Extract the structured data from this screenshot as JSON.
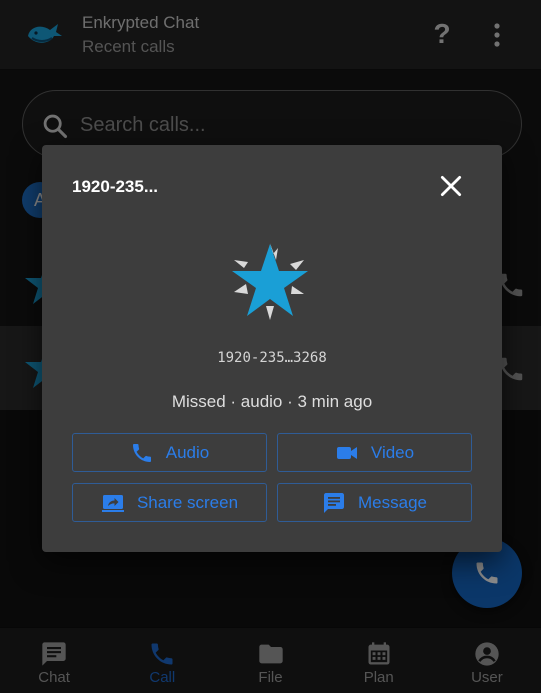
{
  "app": {
    "title": "Enkrypted Chat",
    "subtitle": "Recent calls",
    "help_icon": "?"
  },
  "search": {
    "placeholder": "Search calls..."
  },
  "list": {
    "avatar_letter": "A"
  },
  "dialog": {
    "title": "1920-235...",
    "number": "1920-235…3268",
    "status": "Missed · audio · 3 min ago",
    "buttons": {
      "audio": "Audio",
      "video": "Video",
      "share": "Share screen",
      "message": "Message"
    }
  },
  "nav": {
    "chat": "Chat",
    "call": "Call",
    "file": "File",
    "plan": "Plan",
    "user": "User"
  },
  "colors": {
    "accent": "#1e66c8",
    "fab": "#1565c0",
    "star": "#1a9fd6",
    "dialog_bg": "#3d3d3d"
  }
}
